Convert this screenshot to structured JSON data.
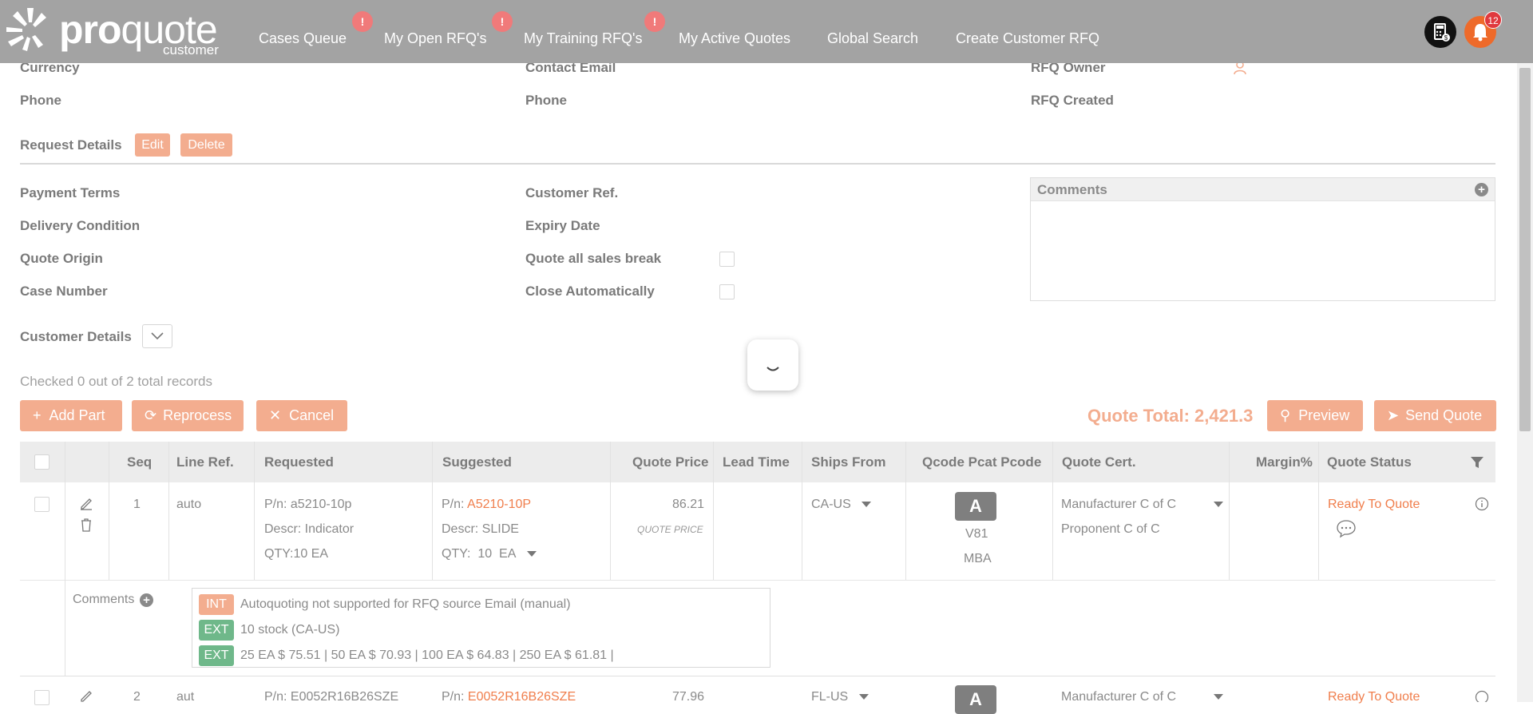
{
  "brand": {
    "name_bold": "pro",
    "name_light": "quote",
    "sub": "customer"
  },
  "nav": [
    {
      "label": "Cases Queue",
      "badge": "!"
    },
    {
      "label": "My Open RFQ's",
      "badge": "!"
    },
    {
      "label": "My Training RFQ's",
      "badge": "!"
    },
    {
      "label": "My Active Quotes"
    },
    {
      "label": "Global Search"
    },
    {
      "label": "Create Customer RFQ"
    }
  ],
  "notifications": {
    "count": "12"
  },
  "header_fields": {
    "currency": "Currency",
    "contact_email": "Contact Email",
    "rfq_owner": "RFQ Owner",
    "phone_left": "Phone",
    "phone_mid": "Phone",
    "rfq_created": "RFQ Created"
  },
  "request_details": {
    "title": "Request Details",
    "edit": "Edit",
    "delete": "Delete"
  },
  "details": {
    "payment_terms": "Payment Terms",
    "delivery_condition": "Delivery Condition",
    "quote_origin": "Quote Origin",
    "case_number": "Case Number",
    "customer_ref": "Customer Ref.",
    "expiry_date": "Expiry Date",
    "quote_all_sales_break": "Quote all sales break",
    "close_automatically": "Close Automatically"
  },
  "comments_panel": {
    "title": "Comments"
  },
  "customer_details": {
    "label": "Customer Details"
  },
  "records_status": "Checked 0 out of 2 total records",
  "actions": {
    "add_part": "Add Part",
    "reprocess": "Reprocess",
    "cancel": "Cancel",
    "preview": "Preview",
    "send_quote": "Send Quote"
  },
  "quote_total": "Quote Total: 2,421.3",
  "table": {
    "headers": [
      "Seq",
      "Line Ref.",
      "Requested",
      "Suggested",
      "Quote Price",
      "Lead Time",
      "Ships From",
      "Qcode Pcat Pcode",
      "Quote Cert.",
      "Margin%",
      "Quote Status"
    ],
    "rows": [
      {
        "seq": "1",
        "line_ref": "auto",
        "req_pn": "P/n: a5210-10p",
        "req_descr": "Descr: Indicator",
        "req_qty": "QTY:10 EA",
        "sug_pn_label": "P/n:",
        "sug_pn": "A5210-10P",
        "sug_descr": "Descr: SLIDE",
        "sug_qty_label": "QTY:",
        "sug_qty": "10",
        "sug_unit": "EA",
        "quote_price": "86.21",
        "quote_price_sub": "QUOTE PRICE",
        "ships_from": "CA-US",
        "qcode": "A",
        "pcat": "V81",
        "pcode": "MBA",
        "cert_1": "Manufacturer C of C",
        "cert_2": "Proponent C of C",
        "status": "Ready To Quote"
      },
      {
        "seq": "2",
        "line_ref": "aut",
        "req_pn": "P/n: E0052R16B26SZE",
        "sug_pn_label": "P/n:",
        "sug_pn": "E0052R16B26SZE",
        "quote_price": "77.96",
        "ships_from": "FL-US",
        "qcode": "A",
        "cert_1": "Manufacturer C of C",
        "status": "Ready To Quote"
      }
    ],
    "comments_label": "Comments",
    "comments": [
      {
        "tag": "INT",
        "text": "Autoquoting not supported for RFQ source Email (manual)"
      },
      {
        "tag": "EXT",
        "text": "10 stock (CA-US)"
      },
      {
        "tag": "EXT",
        "text": "25 EA $ 75.51 | 50 EA $ 70.93 | 100 EA $ 64.83 | 250 EA $ 61.81 |"
      }
    ]
  },
  "colors": {
    "accent": "#f3ad8f",
    "topbar": "#a3a3a3",
    "link": "#f07e4c",
    "ext_tag": "#6fb88a"
  }
}
